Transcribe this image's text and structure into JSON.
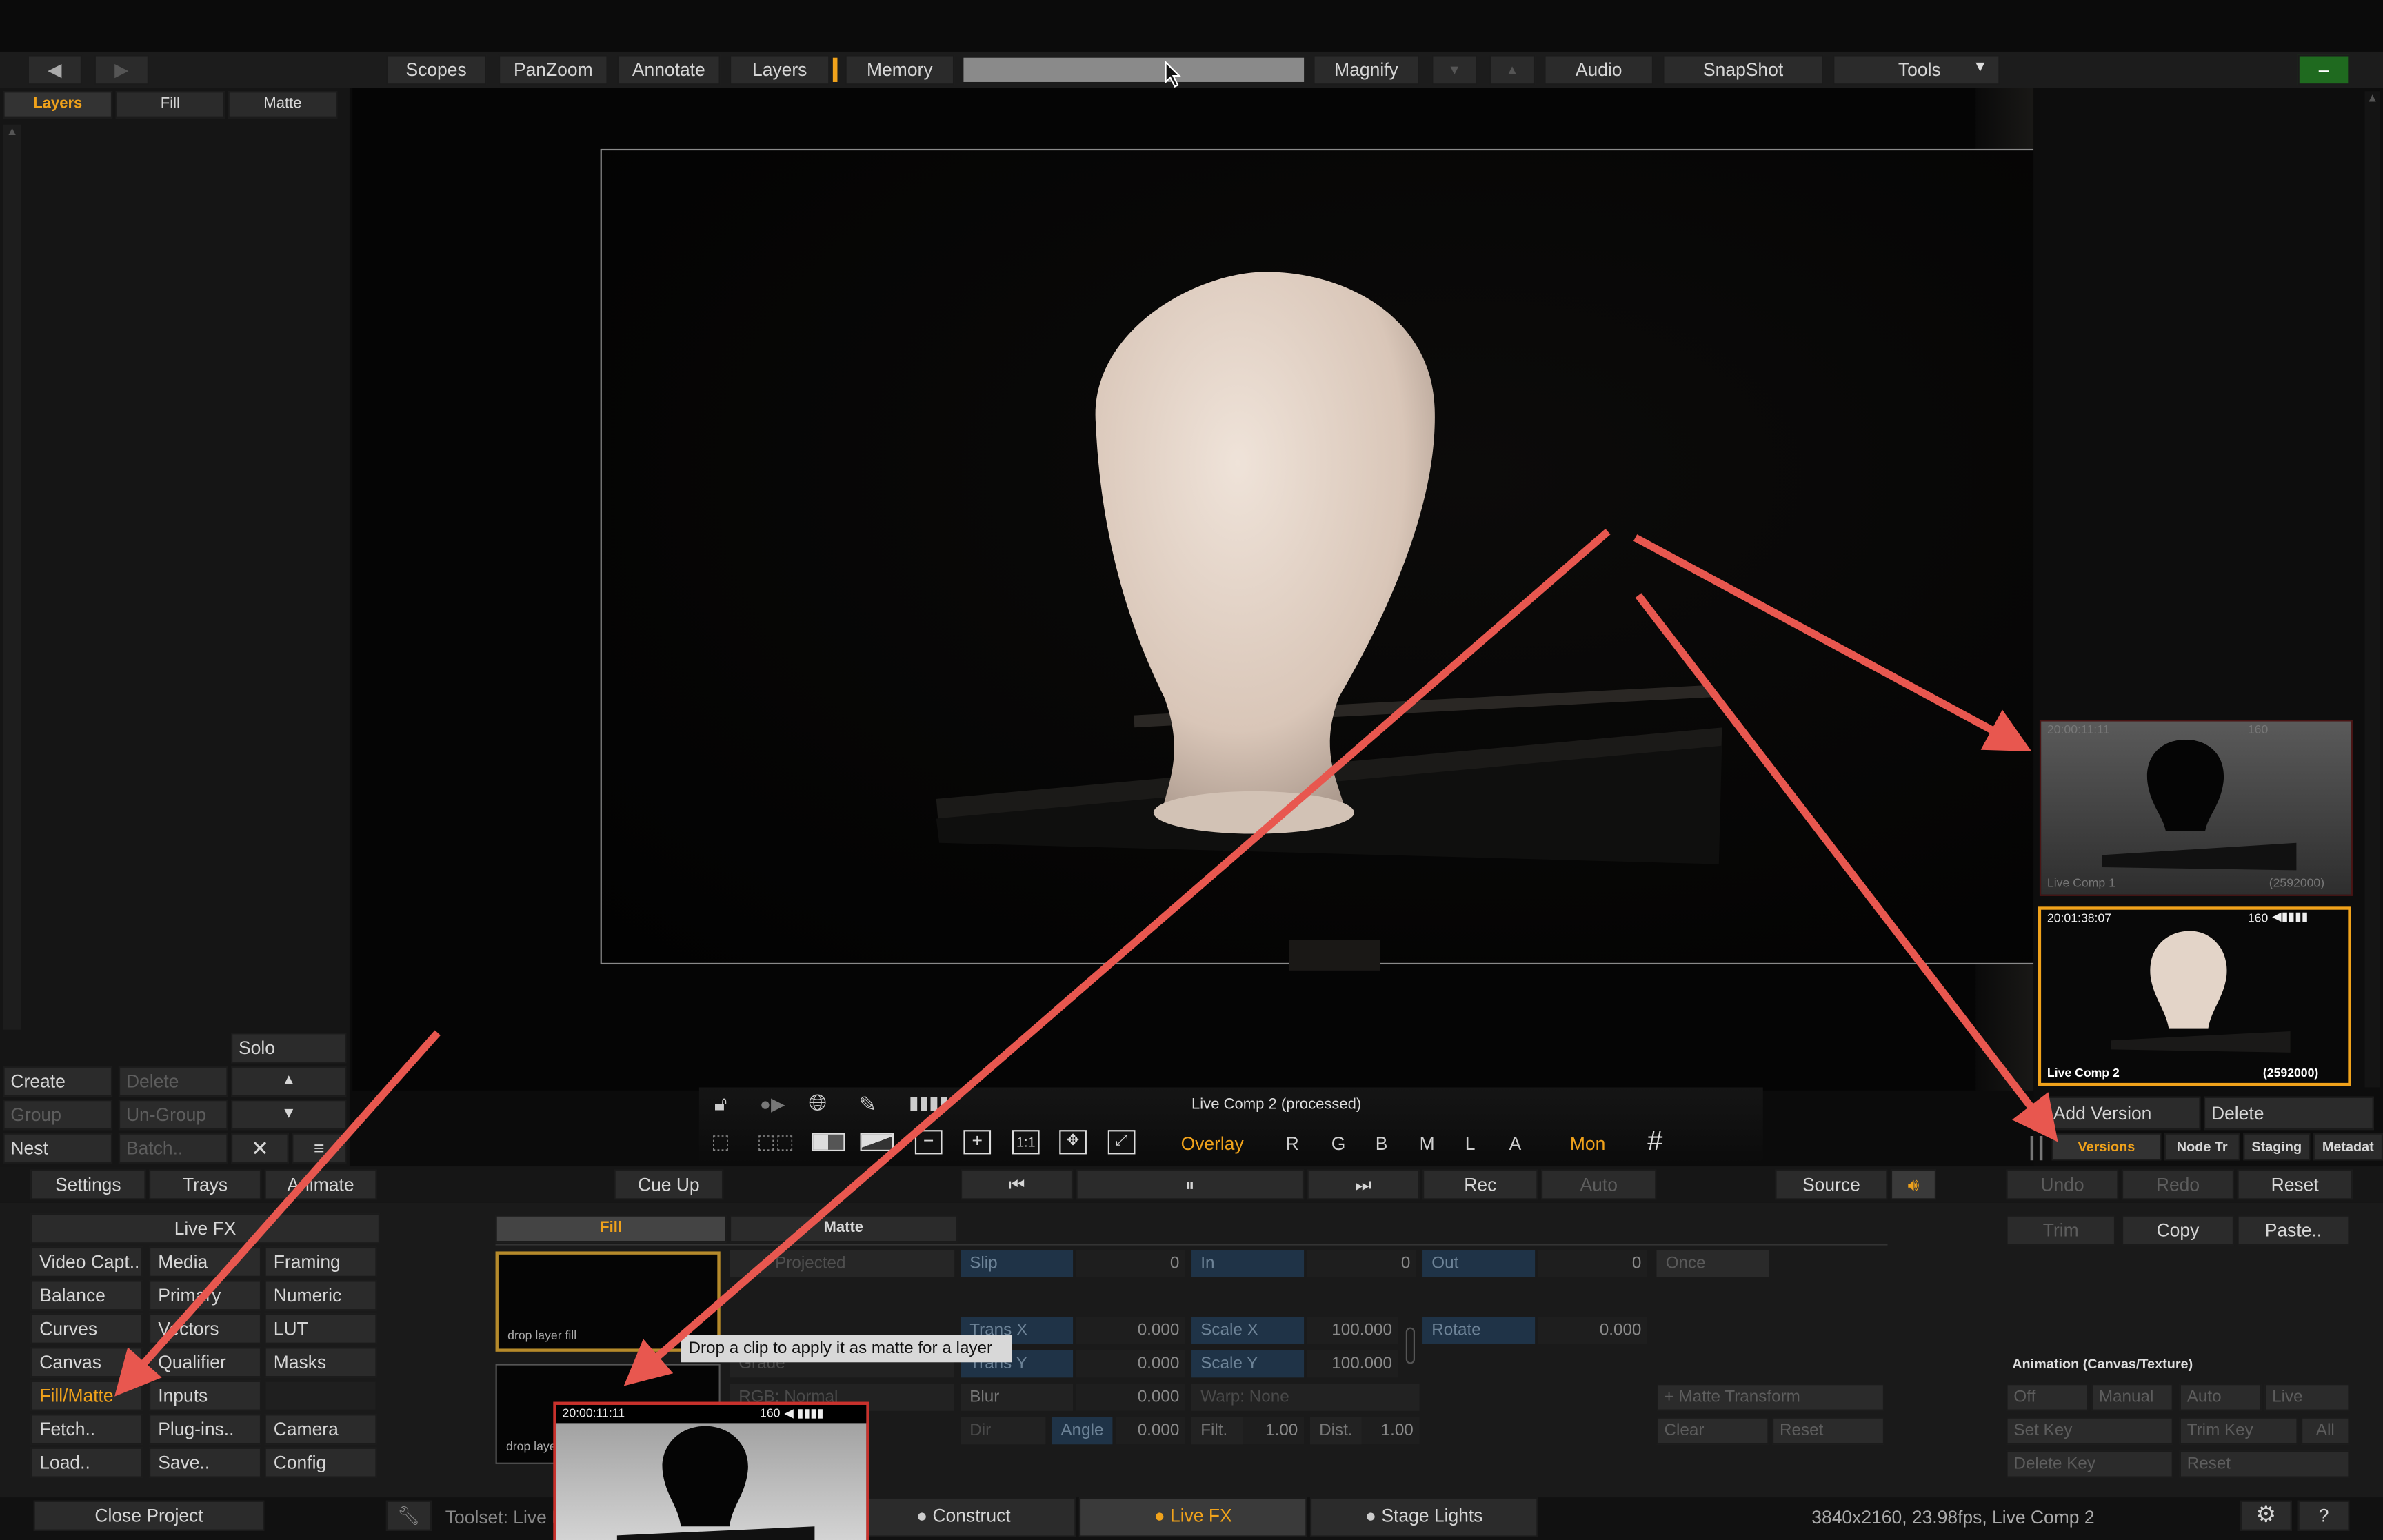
{
  "colors": {
    "accent": "#f0a21b",
    "arrow": "#e8574f",
    "field": "#1f3347",
    "panel": "#1a1a1a"
  },
  "toolbar": {
    "scopes": "Scopes",
    "panzoom": "PanZoom",
    "annotate": "Annotate",
    "layers": "Layers",
    "memory": "Memory",
    "magnify": "Magnify",
    "audio": "Audio",
    "snapshot": "SnapShot",
    "tools": "Tools",
    "minimize": "–"
  },
  "left_tabs": {
    "layers": "Layers",
    "fill": "Fill",
    "matte": "Matte"
  },
  "layer_controls": {
    "solo": "Solo",
    "create": "Create",
    "delete": "Delete",
    "group": "Group",
    "ungroup": "Un-Group",
    "nest": "Nest",
    "batch": "Batch.."
  },
  "viewer": {
    "clip_label": "Live Comp 2 (processed)",
    "overlay": "Overlay",
    "r": "R",
    "g": "G",
    "b": "B",
    "m": "M",
    "l": "L",
    "a": "A",
    "mon": "Mon",
    "ratio": "1:1"
  },
  "thumbs": {
    "t1_tc": "20:00:11:11",
    "t1_name": "Live Comp 1",
    "t1_frames": "(2592000)",
    "t1_count": "160",
    "t2_tc": "20:01:38:07",
    "t2_count": "160",
    "t2_name": "Live Comp 2",
    "t2_frames": "(2592000)"
  },
  "right_panel": {
    "add_version": "Add Version",
    "delete": "Delete",
    "tab_versions": "Versions",
    "tab_node": "Node Tr",
    "tab_staging": "Staging",
    "tab_metadata": "Metadat"
  },
  "transport": {
    "settings": "Settings",
    "trays": "Trays",
    "animate": "Animate",
    "cueup": "Cue Up",
    "rec": "Rec",
    "auto": "Auto",
    "source": "Source",
    "undo": "Undo",
    "redo": "Redo",
    "reset": "Reset"
  },
  "menu": {
    "title": "Live FX",
    "items": [
      "Video Capt..",
      "Media",
      "Framing",
      "Balance",
      "Primary",
      "Numeric",
      "Curves",
      "Vectors",
      "LUT",
      "Canvas",
      "Qualifier",
      "Masks",
      "Fill/Matte",
      "Inputs",
      "",
      "Fetch..",
      "Plug-ins..",
      "Camera",
      "Load..",
      "Save..",
      "Config"
    ]
  },
  "fillmatte": {
    "fill_tab": "Fill",
    "matte_tab": "Matte",
    "drop_fill": "drop layer fill",
    "drop_matte": "drop layer",
    "tooltip": "Drop a clip to apply it as matte for a layer",
    "projected": "Projected",
    "slip": "Slip",
    "slip_val": "0",
    "in": "In",
    "in_val": "0",
    "out": "Out",
    "out_val": "0",
    "once": "Once",
    "transx": "Trans X",
    "transx_val": "0.000",
    "scalex": "Scale X",
    "scalex_val": "100.000",
    "rotate": "Rotate",
    "rotate_val": "0.000",
    "transy": "Trans Y",
    "transy_val": "0.000",
    "scaley": "Scale Y",
    "scaley_val": "100.000",
    "grade": "Grade",
    "rgb": "RGB: Normal",
    "blur": "Blur",
    "blur_val": "0.000",
    "warp": "Warp: None",
    "dir": "Dir",
    "angle": "Angle",
    "angle_val": "0.000",
    "filt": "Filt.",
    "filt_val": "1.00",
    "dist": "Dist.",
    "dist_val": "1.00",
    "matte_transform": "+ Matte Transform",
    "clear": "Clear",
    "reset": "Reset"
  },
  "editpanel": {
    "trim": "Trim",
    "copy": "Copy",
    "paste": "Paste..",
    "anim_title": "Animation (Canvas/Texture)",
    "off": "Off",
    "manual": "Manual",
    "auto": "Auto",
    "live": "Live",
    "set_key": "Set Key",
    "trim_key": "Trim Key",
    "all": "All",
    "delete_key": "Delete Key",
    "reset": "Reset"
  },
  "drag_thumb": {
    "tc": "20:00:11:11",
    "count": "160"
  },
  "statusbar": {
    "close": "Close Project",
    "toolset": "Toolset: Live FX",
    "construct": "Construct",
    "livefx": "Live FX",
    "stagelights": "Stage Lights",
    "info": "3840x2160, 23.98fps, Live Comp 2"
  }
}
